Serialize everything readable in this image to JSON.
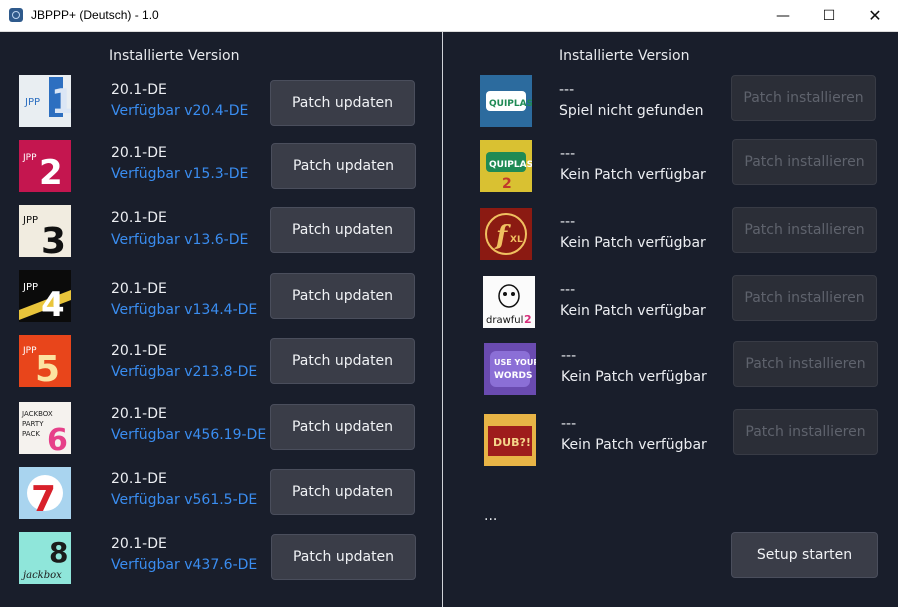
{
  "window": {
    "title": "JBPPP+ (Deutsch) - 1.0",
    "min_glyph": "—",
    "max_glyph": "☐",
    "close_glyph": "✕"
  },
  "left": {
    "header": "Installierte Version",
    "rows": [
      {
        "icon": "jpp1-icon",
        "version": "20.1-DE",
        "available": "Verfügbar v20.4-DE",
        "button": "Patch updaten"
      },
      {
        "icon": "jpp2-icon",
        "version": "20.1-DE",
        "available": "Verfügbar v15.3-DE",
        "button": "Patch updaten"
      },
      {
        "icon": "jpp3-icon",
        "version": "20.1-DE",
        "available": "Verfügbar v13.6-DE",
        "button": "Patch updaten"
      },
      {
        "icon": "jpp4-icon",
        "version": "20.1-DE",
        "available": "Verfügbar v134.4-DE",
        "button": "Patch updaten"
      },
      {
        "icon": "jpp5-icon",
        "version": "20.1-DE",
        "available": "Verfügbar v213.8-DE",
        "button": "Patch updaten"
      },
      {
        "icon": "jpp6-icon",
        "version": "20.1-DE",
        "available": "Verfügbar v456.19-DE",
        "button": "Patch updaten"
      },
      {
        "icon": "jpp7-icon",
        "version": "20.1-DE",
        "available": "Verfügbar v561.5-DE",
        "button": "Patch updaten"
      },
      {
        "icon": "jpp8-icon",
        "version": "20.1-DE",
        "available": "Verfügbar v437.6-DE",
        "button": "Patch updaten"
      }
    ]
  },
  "right": {
    "header": "Installierte Version",
    "rows": [
      {
        "icon": "quiplash-icon",
        "version": "---",
        "status": "Spiel nicht gefunden",
        "button": "Patch installieren"
      },
      {
        "icon": "quiplash2-icon",
        "version": "---",
        "status": "Kein Patch verfügbar",
        "button": "Patch installieren"
      },
      {
        "icon": "fibbage-xl-icon",
        "version": "---",
        "status": "Kein Patch verfügbar",
        "button": "Patch installieren"
      },
      {
        "icon": "drawful2-icon",
        "version": "---",
        "status": "Kein Patch verfügbar",
        "button": "Patch installieren"
      },
      {
        "icon": "use-your-words-icon",
        "version": "---",
        "status": "Kein Patch verfügbar",
        "button": "Patch installieren"
      },
      {
        "icon": "dubg-icon",
        "version": "---",
        "status": "Kein Patch verfügbar",
        "button": "Patch installieren"
      }
    ],
    "more": "...",
    "setup_button": "Setup starten"
  }
}
